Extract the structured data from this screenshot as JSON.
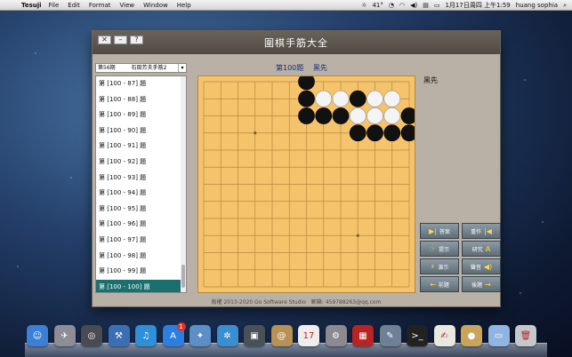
{
  "menubar": {
    "apple_icon": "apple-icon",
    "app_name": "Tesuji",
    "menus": [
      "File",
      "Edit",
      "Format",
      "View",
      "Window",
      "Help"
    ],
    "temperature": "41°",
    "datetime": "1月17日周四 上午1:59",
    "user": "huang sophia"
  },
  "window": {
    "title": "圍棋手筋大全",
    "buttons": [
      "✕",
      "–",
      "?"
    ]
  },
  "selector": {
    "value": "第56期　　　石田芳夫手筋2"
  },
  "problems": [
    "第 [100 - 87] 題",
    "第 [100 - 88] 題",
    "第 [100 - 89] 題",
    "第 [100 - 90] 題",
    "第 [100 - 91] 題",
    "第 [100 - 92] 題",
    "第 [100 - 93] 題",
    "第 [100 - 94] 題",
    "第 [100 - 95] 題",
    "第 [100 - 96] 題",
    "第 [100 - 97] 題",
    "第 [100 - 98] 題",
    "第 [100 - 99] 題",
    "第 [100 - 100] 題"
  ],
  "selected_problem": 13,
  "problem_header": {
    "title": "第100題",
    "to_move": "黑先"
  },
  "side_hint": "黑先",
  "board": {
    "size": 13,
    "black": [
      [
        6,
        0
      ],
      [
        6,
        1
      ],
      [
        9,
        1
      ],
      [
        6,
        2
      ],
      [
        7,
        2
      ],
      [
        8,
        2
      ],
      [
        12,
        2
      ],
      [
        9,
        3
      ],
      [
        10,
        3
      ],
      [
        11,
        3
      ],
      [
        12,
        3
      ]
    ],
    "white": [
      [
        7,
        1
      ],
      [
        8,
        1
      ],
      [
        10,
        1
      ],
      [
        11,
        1
      ],
      [
        9,
        2
      ],
      [
        10,
        2
      ],
      [
        11,
        2
      ]
    ]
  },
  "buttons": [
    {
      "label": "答案",
      "icon": "skip-forward-icon",
      "glyph": "▶|"
    },
    {
      "label": "重作",
      "icon": "skip-back-icon",
      "glyph": "|◀"
    },
    {
      "label": "提示",
      "icon": "hint-icon",
      "glyph": "☞"
    },
    {
      "label": "研究",
      "icon": "research-icon",
      "glyph": "A"
    },
    {
      "label": "演示",
      "icon": "demo-icon",
      "glyph": "⚡"
    },
    {
      "label": "聲音",
      "icon": "speaker-icon",
      "glyph": "◀)"
    },
    {
      "label": "前題",
      "icon": "arrow-left-icon",
      "glyph": "←"
    },
    {
      "label": "後題",
      "icon": "arrow-right-icon",
      "glyph": "→"
    }
  ],
  "footer": "版權 2013-2020 Go Software Studio　郵箱: 459788263@qq.com",
  "dock": [
    {
      "icon": "finder-icon",
      "color": "#3b7fd6",
      "glyph": "☺"
    },
    {
      "icon": "launchpad-icon",
      "color": "#8d8d95",
      "glyph": "✈"
    },
    {
      "icon": "dashboard-icon",
      "color": "#4a4a52",
      "glyph": "◎"
    },
    {
      "icon": "xcode-icon",
      "color": "#3b6fb5",
      "glyph": "⚒"
    },
    {
      "icon": "itunes-icon",
      "color": "#2f8fd8",
      "glyph": "♫"
    },
    {
      "icon": "app-store-icon",
      "color": "#2a7fe0",
      "glyph": "A"
    },
    {
      "icon": "preview-icon",
      "color": "#5a8fc8",
      "glyph": "✦"
    },
    {
      "icon": "safari-icon",
      "color": "#3a8fd0",
      "glyph": "✲"
    },
    {
      "icon": "facetime-icon",
      "color": "#4a5058",
      "glyph": "▣"
    },
    {
      "icon": "contacts-icon",
      "color": "#b89154",
      "glyph": "@"
    },
    {
      "icon": "calendar-icon",
      "color": "#eeeeee",
      "glyph": "17"
    },
    {
      "icon": "system-preferences-icon",
      "color": "#8a8a90",
      "glyph": "⚙"
    },
    {
      "icon": "photo-booth-icon",
      "color": "#b82323",
      "glyph": "▦"
    },
    {
      "icon": "utility-icon",
      "color": "#6f7f95",
      "glyph": "✎"
    },
    {
      "icon": "terminal-icon",
      "color": "#222222",
      "glyph": ">_"
    },
    {
      "icon": "textedit-icon",
      "color": "#e8e8e0",
      "glyph": "✍"
    },
    {
      "icon": "tesuji-icon",
      "color": "#c9a45a",
      "glyph": "●"
    },
    {
      "icon": "folder-icon",
      "color": "#8fb6e0",
      "glyph": "▭"
    },
    {
      "icon": "trash-icon",
      "color": "#c4c8cc",
      "glyph": "🗑"
    }
  ],
  "badge_app_store": "1"
}
